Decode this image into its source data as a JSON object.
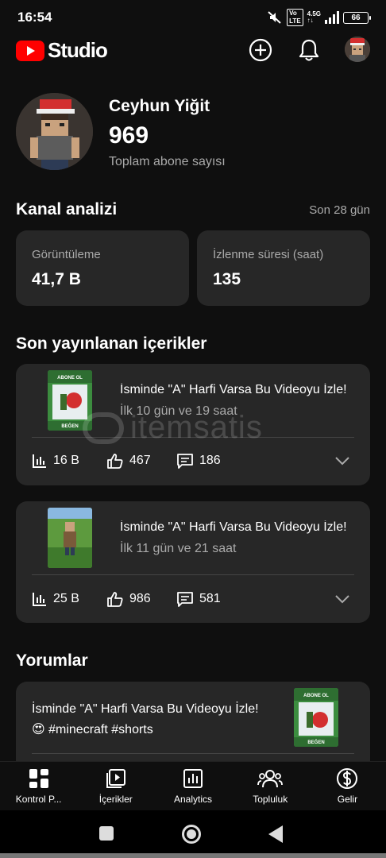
{
  "status_bar": {
    "time": "16:54",
    "network": "4.5G",
    "battery": "66",
    "icons": [
      "mute-icon",
      "volte-icon",
      "signal-icon",
      "battery-icon"
    ]
  },
  "app_bar": {
    "logo_text": "Studio",
    "icons": [
      "create-icon",
      "notifications-icon",
      "account-avatar"
    ]
  },
  "channel": {
    "name": "Ceyhun Yiğit",
    "subscriber_count": "969",
    "subscriber_label": "Toplam abone sayısı"
  },
  "analytics": {
    "title": "Kanal analizi",
    "period": "Son 28 gün",
    "stats": [
      {
        "label": "Görüntüleme",
        "value": "41,7 B"
      },
      {
        "label": "İzlenme süresi (saat)",
        "value": "135"
      }
    ]
  },
  "recent": {
    "title": "Son yayınlanan içerikler",
    "videos": [
      {
        "title": "İsminde \"A\" Harfi Varsa Bu Videoyu İzle!",
        "subtitle": "İlk 10 gün ve 19 saat",
        "views": "16 B",
        "likes": "467",
        "comments": "186",
        "thumb_top_text": "ABONE OL",
        "thumb_bottom_text": "BEĞEN"
      },
      {
        "title": "İsminde \"A\" Harfi Varsa Bu Videoyu İzle!",
        "subtitle": "İlk 11 gün ve 21 saat",
        "views": "25 B",
        "likes": "986",
        "comments": "581"
      }
    ]
  },
  "comments": {
    "title": "Yorumlar",
    "items": [
      {
        "text": "İsminde \"A\" Harfi Varsa Bu Videoyu İzle! 😍 #minecraft #shorts",
        "thumb_top_text": "ABONE OL",
        "thumb_bottom_text": "BEĞEN"
      }
    ]
  },
  "watermark": "itemsatis",
  "bottom_nav": [
    {
      "label": "Kontrol P...",
      "icon": "dashboard-icon"
    },
    {
      "label": "İçerikler",
      "icon": "content-icon"
    },
    {
      "label": "Analytics",
      "icon": "analytics-icon"
    },
    {
      "label": "Topluluk",
      "icon": "community-icon"
    },
    {
      "label": "Gelir",
      "icon": "earn-icon"
    }
  ],
  "colors": {
    "brand_red": "#ff0000",
    "background": "#0f0f0f",
    "card": "#272727",
    "secondary_text": "#aaaaaa"
  }
}
